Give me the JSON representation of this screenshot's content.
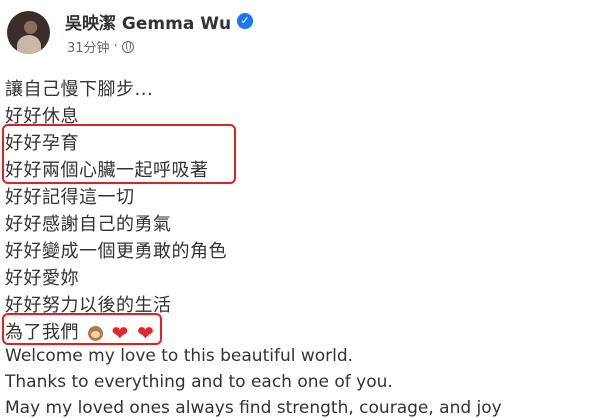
{
  "post": {
    "author": "吳映潔 Gemma Wu",
    "time": "31分钟",
    "separator": "·",
    "verified_icon": "verified-badge-icon",
    "privacy_icon": "globe-icon",
    "lines": [
      "讓自己慢下腳步...",
      "好好休息",
      "好好孕育",
      "好好兩個心臟一起呼吸著",
      "好好記得這一切",
      "好好感謝自己的勇氣",
      "好好變成一個更勇敢的角色",
      "好好愛妳",
      "好好努力以後的生活",
      "為了我們"
    ],
    "emojis": [
      "monkey-emoji",
      "red-heart-emoji",
      "red-heart-emoji"
    ],
    "english_lines": [
      "Welcome my love to this beautiful world.",
      "Thanks to everything and to each one of you.",
      "May my loved ones always find strength, courage, and joy"
    ],
    "highlight_color": "#e0211f"
  }
}
